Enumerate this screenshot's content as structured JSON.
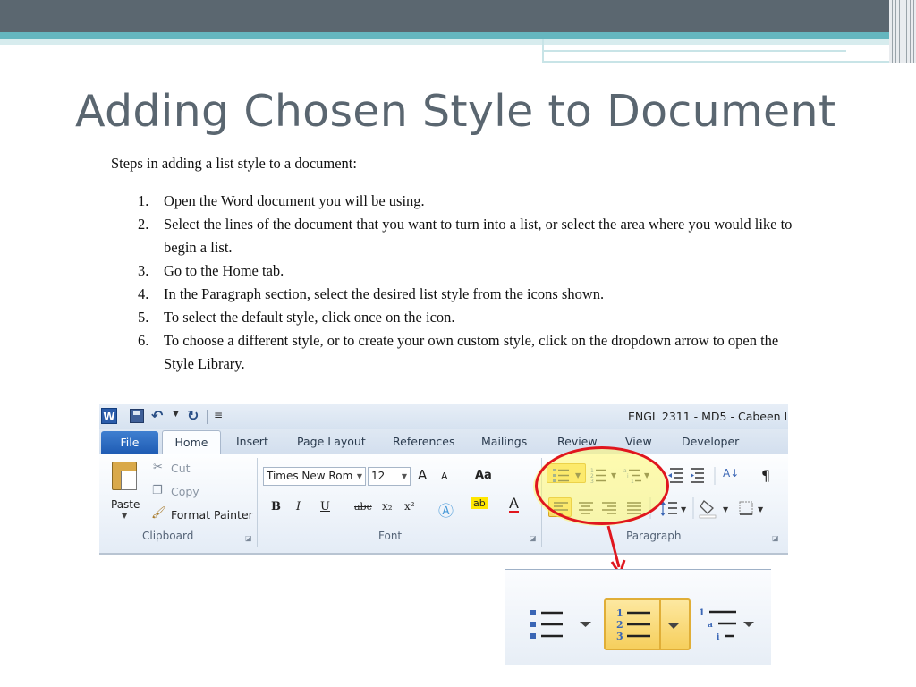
{
  "slide": {
    "title": "Adding Chosen Style to Document",
    "intro": "Steps in adding a list style to a document:",
    "steps": [
      {
        "num": "1.",
        "text": "Open the Word document you will be using."
      },
      {
        "num": "2.",
        "text": "Select the lines of the document that you want to turn into a list, or select the area where you would like to begin a list."
      },
      {
        "num": "3.",
        "text": "Go to the Home tab."
      },
      {
        "num": "4.",
        "text": "In the Paragraph section, select the desired list style from the icons shown."
      },
      {
        "num": "5.",
        "text": "To select the default style, click once on the icon."
      },
      {
        "num": "6.",
        "text": "To choose a different style, or to create your own custom style, click on the dropdown arrow to open the Style Library."
      }
    ]
  },
  "ribbon": {
    "window_title": "ENGL 2311 - MD5 - Cabeen I",
    "app_icon_letter": "W",
    "tabs": [
      "File",
      "Home",
      "Insert",
      "Page Layout",
      "References",
      "Mailings",
      "Review",
      "View",
      "Developer"
    ],
    "clipboard": {
      "paste": "Paste",
      "cut": "Cut",
      "copy": "Copy",
      "format_painter": "Format Painter",
      "group_label": "Clipboard"
    },
    "font": {
      "font_name": "Times New Rom",
      "font_size": "12",
      "grow": "A",
      "shrink": "A",
      "change_case": "Aa",
      "bold": "B",
      "italic": "I",
      "underline": "U",
      "strike": "abc",
      "subscript": "x₂",
      "superscript": "x²",
      "highlight": "ab",
      "font_color": "A",
      "group_label": "Font"
    },
    "paragraph": {
      "group_label": "Paragraph",
      "pilcrow": "¶",
      "sort": "A↓"
    }
  },
  "colors": {
    "title": "#5a6670",
    "band_dark": "#5b6770",
    "band_teal": "#65b6bf",
    "highlight": "#f8d96a",
    "annotation_red": "#e0161e"
  }
}
